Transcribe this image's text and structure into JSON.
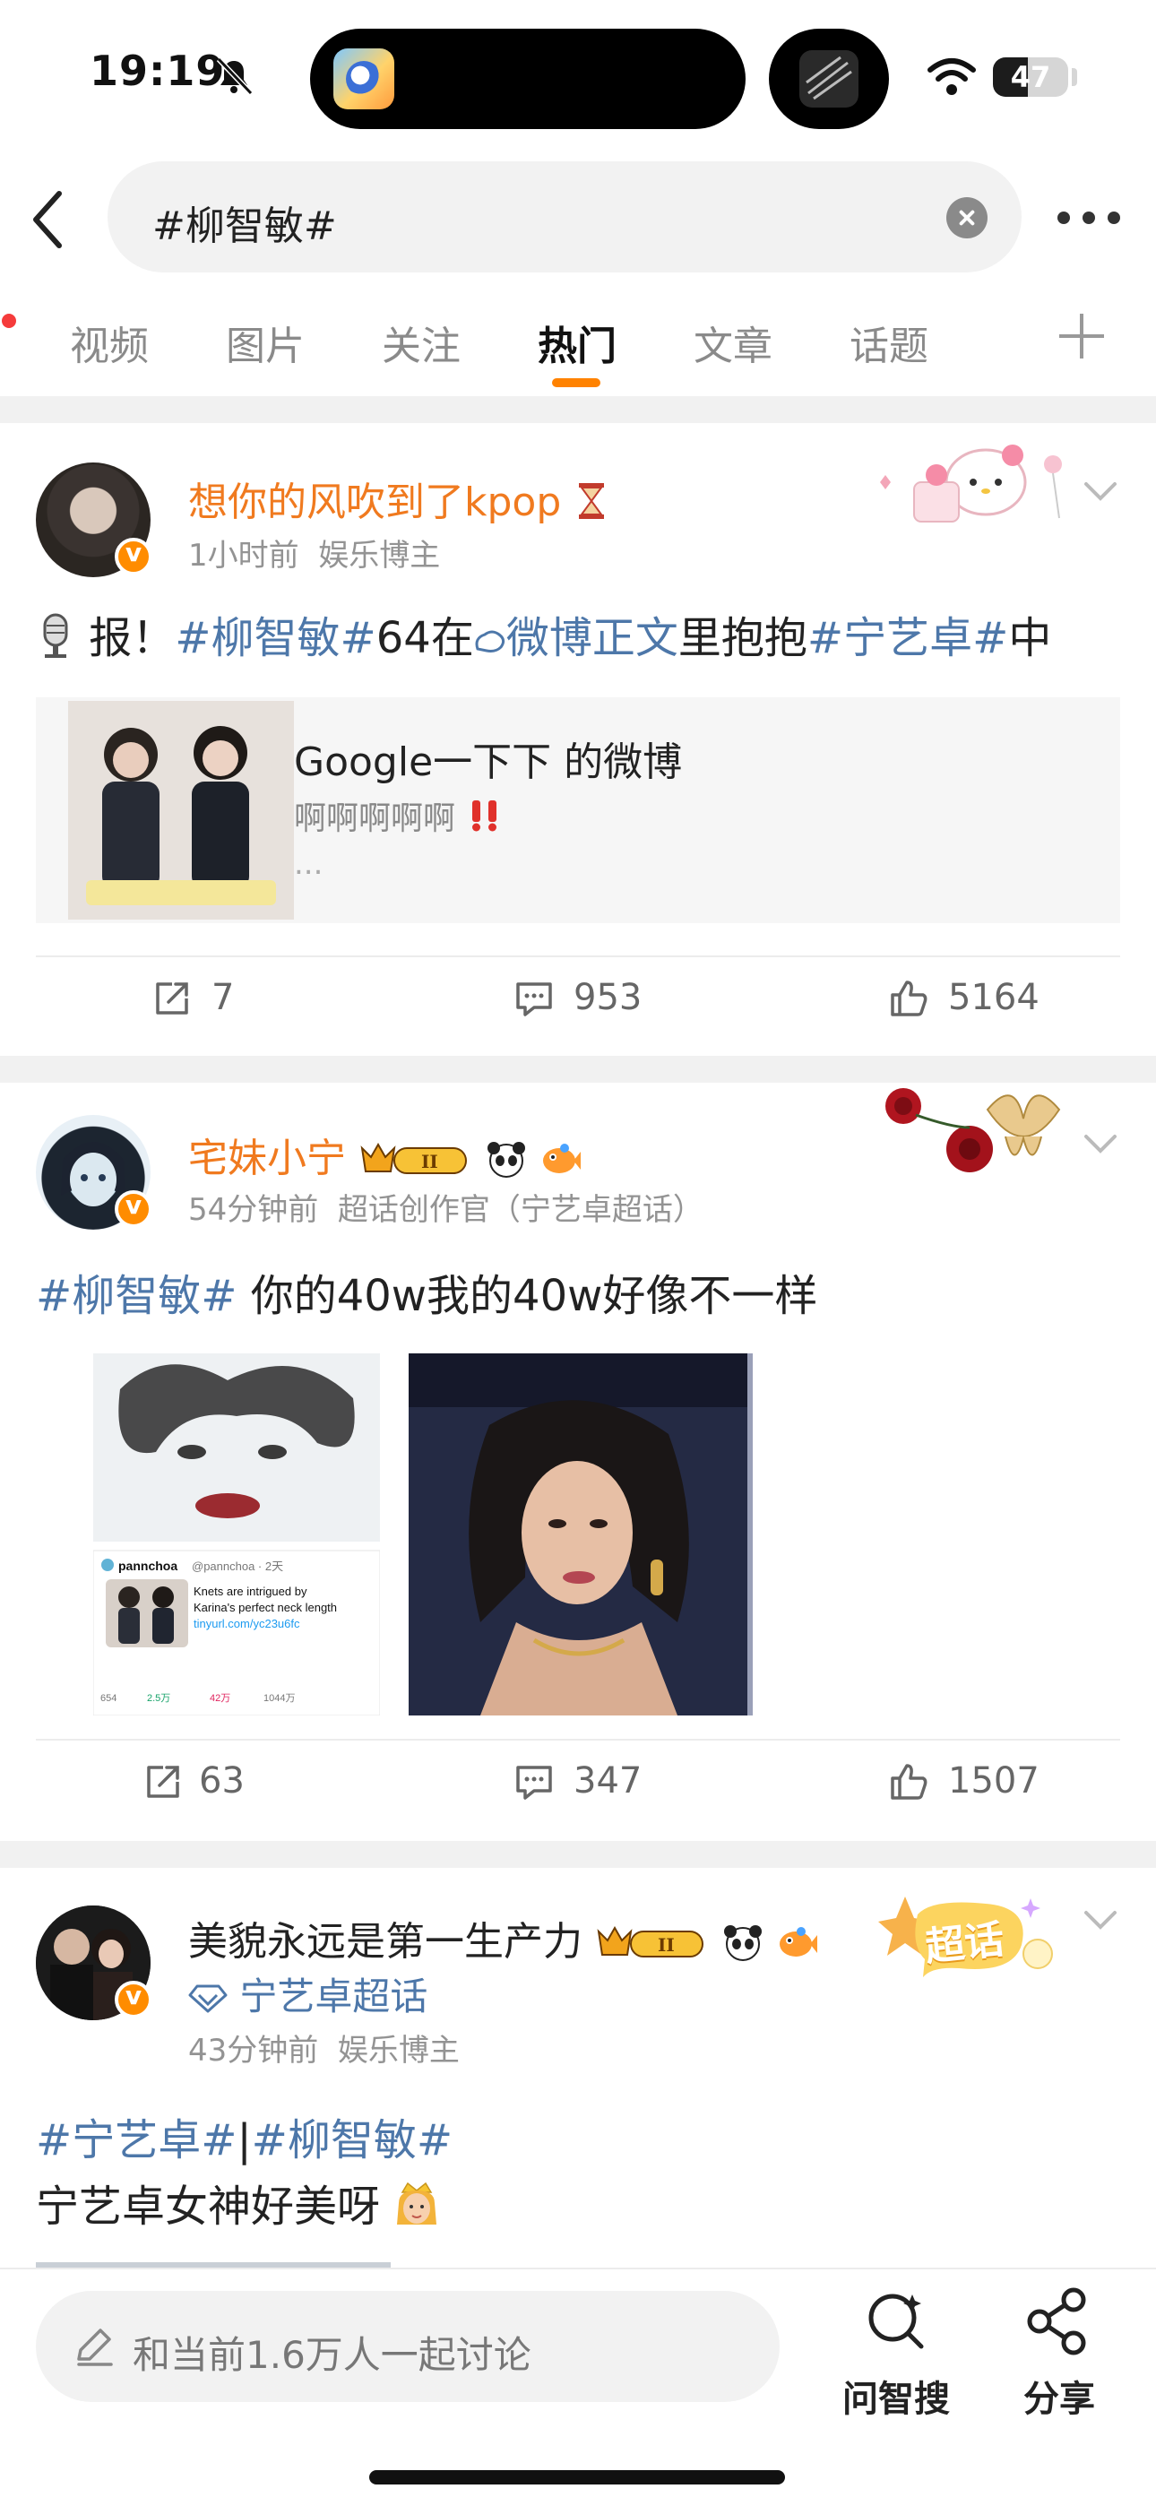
{
  "status_bar": {
    "time": "19:19",
    "battery": "47",
    "battery_level": 0.47
  },
  "search": {
    "query": "#柳智敏#"
  },
  "tabs": [
    {
      "label": "视频",
      "active": false
    },
    {
      "label": "图片",
      "active": false
    },
    {
      "label": "关注",
      "active": false
    },
    {
      "label": "热门",
      "active": true
    },
    {
      "label": "文章",
      "active": false
    },
    {
      "label": "话题",
      "active": false
    }
  ],
  "posts": [
    {
      "username": "想你的风吹到了kpop",
      "time": "1小时前",
      "role": "娱乐博主",
      "text_prefix": "报！",
      "tag1": "#柳智敏#",
      "text_mid": "64在",
      "link": "微博正文",
      "text_mid2": "里抱抱",
      "tag2": "#宁艺卓#",
      "text_end": "中",
      "repost": {
        "title": "Google一下下 的微博",
        "subtitle": "啊啊啊啊啊",
        "ellipsis": "..."
      },
      "actions": {
        "reposts": "7",
        "comments": "953",
        "likes": "5164"
      }
    },
    {
      "username": "宅妹小宁",
      "time": "54分钟前",
      "role": "超话创作官（宁艺卓超话）",
      "tag1": "#柳智敏#",
      "text": "你的40w我的40w好像不一样",
      "embed": {
        "handle": "pannchoa",
        "handle_at": "@pannchoa · 2天",
        "tweet_line1": "Knets are intrigued by",
        "tweet_line2": "Karina's perfect neck length",
        "tweet_link": "tinyurl.com/yc23u6fc",
        "stats": [
          "654",
          "2.5万",
          "42万",
          "1044万"
        ]
      },
      "actions": {
        "reposts": "63",
        "comments": "347",
        "likes": "1507"
      }
    },
    {
      "username": "美貌永远是第一生产力",
      "supertopic": "宁艺卓超话",
      "time": "43分钟前",
      "role": "娱乐博主",
      "tag1": "#宁艺卓#",
      "divider": "|",
      "tag2": "#柳智敏#",
      "text": "宁艺卓女神好美呀",
      "sticker": "超话"
    }
  ],
  "bottom_bar": {
    "comment_placeholder": "和当前1.6万人一起讨论",
    "ask_label": "问智搜",
    "share_label": "分享"
  },
  "colors": {
    "accent": "#ff8200",
    "tag": "#4d77a9",
    "username": "#f07a1f"
  }
}
